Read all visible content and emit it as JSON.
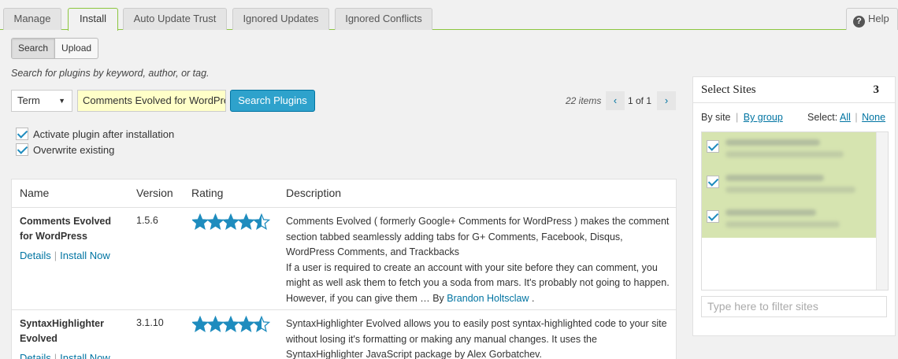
{
  "tabs": [
    {
      "label": "Manage"
    },
    {
      "label": "Install"
    },
    {
      "label": "Auto Update Trust"
    },
    {
      "label": "Ignored Updates"
    },
    {
      "label": "Ignored Conflicts"
    }
  ],
  "help_label": "Help",
  "mode": {
    "search": "Search",
    "upload": "Upload"
  },
  "hint": "Search for plugins by keyword, author, or tag.",
  "search": {
    "term_value": "Term",
    "query_value": "Comments Evolved for WordPress",
    "button": "Search Plugins"
  },
  "pagination": {
    "count": "22 items",
    "prev": "‹",
    "page_text": "1 of 1",
    "next": "›"
  },
  "options": {
    "activate": "Activate plugin after installation",
    "overwrite": "Overwrite existing"
  },
  "table": {
    "headers": {
      "name": "Name",
      "version": "Version",
      "rating": "Rating",
      "description": "Description"
    },
    "rows": [
      {
        "name": "Comments Evolved for WordPress",
        "details": "Details",
        "install": "Install Now",
        "version": "1.5.6",
        "rating": 4.5,
        "description": "Comments Evolved ( formerly Google+ Comments for WordPress ) makes the comment section tabbed seamlessly adding tabs for G+ Comments, Facebook, Disqus, WordPress Comments, and Trackbacks",
        "description2": "If a user is required to create an account with your site before they can comment, you might as well ask them to fetch you a soda from mars. It's probably not going to happen. However, if you can give them …",
        "by": "By",
        "author": "Brandon Holtsclaw",
        "end": "."
      },
      {
        "name": "SyntaxHighlighter Evolved",
        "details": "Details",
        "install": "Install Now",
        "version": "3.1.10",
        "rating": 4.5,
        "description": "SyntaxHighlighter Evolved allows you to easily post syntax-highlighted code to your site without losing it's formatting or making any manual changes. It uses the SyntaxHighlighter JavaScript package by Alex Gorbatchev."
      }
    ]
  },
  "sites_panel": {
    "title": "Select Sites",
    "count": "3",
    "by_site": "By site",
    "divider": "|",
    "by_group": "By group",
    "select_label": "Select:",
    "all": "All",
    "none": "None",
    "filter_placeholder": "Type here to filter sites"
  },
  "colors": {
    "accent": "#2ea2cc",
    "link": "#0074a2",
    "star": "#1e8cbe",
    "green_border": "#8cc63f",
    "site_highlight": "#d6e4b0"
  }
}
